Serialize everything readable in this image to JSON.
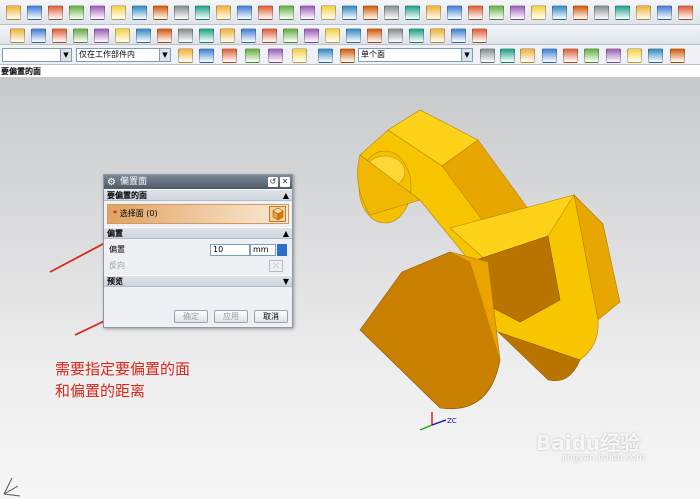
{
  "toolbar": {
    "filter_value": "",
    "scope_value": "仅在工作部件内",
    "face_rule_value": "单个面"
  },
  "command_prompt": "要偏置的面",
  "dialog": {
    "title": "偏置面",
    "section_faces": "要偏置的面",
    "select_face_label": "选择面 (0)",
    "section_offset": "偏置",
    "offset_label": "偏置",
    "offset_value": "10",
    "offset_unit": "mm",
    "reverse_label": "反向",
    "section_preview": "预览",
    "ok_label": "确定",
    "apply_label": "应用",
    "cancel_label": "取消"
  },
  "annotation": {
    "line1": "需要指定要偏置的面",
    "line2": "和偏置的距离"
  },
  "triad": {
    "zc_label": "ZC"
  },
  "watermark": {
    "brand": "Baidu经验",
    "url": "jingyan.baidu.com"
  },
  "colors": {
    "part_yellow": "#f5c400",
    "part_orange": "#c98000",
    "annotation_red": "#d7291c",
    "selection_orange": "#e0a262"
  }
}
